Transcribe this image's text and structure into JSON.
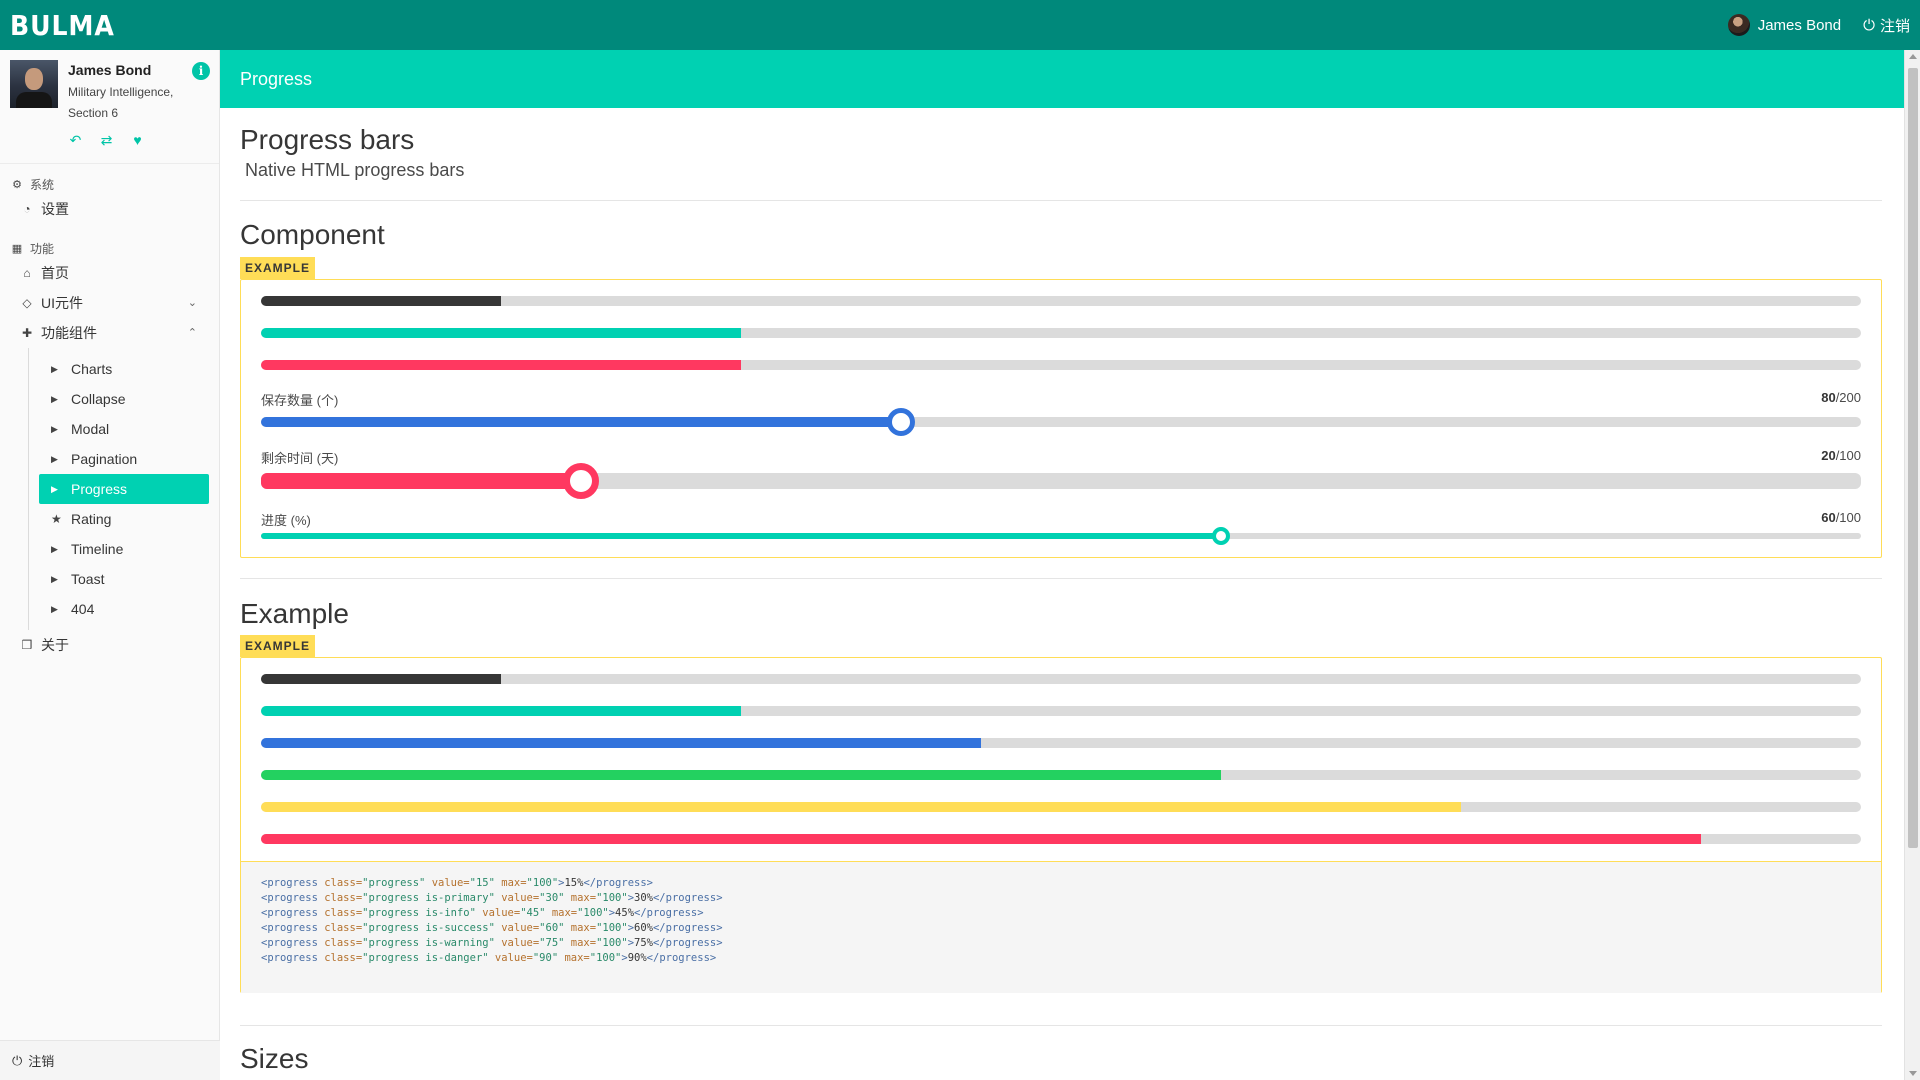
{
  "navbar": {
    "brand": "BULMA",
    "user_name": "James Bond",
    "logout_label": "注销",
    "logout_icon": "power-icon"
  },
  "sidebar": {
    "profile": {
      "name": "James Bond",
      "org": "Military Intelligence, Section 6",
      "info_icon": "info-circle-icon",
      "actions": [
        "reply-icon",
        "retweet-icon",
        "heart-icon"
      ]
    },
    "group_system": {
      "label": "系统",
      "icon": "cogs-icon"
    },
    "settings": {
      "label": "设置",
      "icon": "dashboard-icon"
    },
    "group_features": {
      "label": "功能",
      "icon": "grid-icon"
    },
    "home": {
      "label": "首页",
      "icon": "home-icon"
    },
    "ui": {
      "label": "UI元件",
      "icon": "diamond-icon"
    },
    "components": {
      "label": "功能组件",
      "icon": "puzzle-icon"
    },
    "sub_items": [
      {
        "label": "Charts",
        "icon": "caret-right-icon"
      },
      {
        "label": "Collapse",
        "icon": "caret-right-icon"
      },
      {
        "label": "Modal",
        "icon": "caret-right-icon"
      },
      {
        "label": "Pagination",
        "icon": "caret-right-icon"
      },
      {
        "label": "Progress",
        "icon": "caret-right-icon",
        "active": true
      },
      {
        "label": "Rating",
        "icon": "star-icon"
      },
      {
        "label": "Timeline",
        "icon": "caret-right-icon"
      },
      {
        "label": "Toast",
        "icon": "caret-right-icon"
      },
      {
        "label": "404",
        "icon": "caret-right-icon"
      }
    ],
    "about": {
      "label": "关于",
      "icon": "cube-icon"
    },
    "footer_logout": "注销"
  },
  "hero": {
    "title": "Progress"
  },
  "page": {
    "title": "Progress bars",
    "subtitle": "Native HTML progress bars",
    "component": {
      "title": "Component",
      "badge": "EXAMPLE",
      "bars": [
        {
          "value": 15,
          "max": 100,
          "color": "#363636"
        },
        {
          "value": 30,
          "max": 100,
          "color": "#00d1b2"
        },
        {
          "value": 30,
          "max": 100,
          "color": "#ff3860"
        }
      ],
      "sliders": [
        {
          "label": "保存数量 (个)",
          "value": 80,
          "max": 200,
          "value_text": "80",
          "max_text": "/200",
          "color": "#3273dc"
        },
        {
          "label": "剩余时间 (天)",
          "value": 20,
          "max": 100,
          "value_text": "20",
          "max_text": "/100",
          "color": "#ff3860"
        },
        {
          "label": "进度 (%)",
          "value": 60,
          "max": 100,
          "value_text": "60",
          "max_text": "/100",
          "color": "#00d1b2"
        }
      ]
    },
    "example": {
      "title": "Example",
      "badge": "EXAMPLE",
      "bars": [
        {
          "value": 15,
          "max": 100,
          "color": "#363636"
        },
        {
          "value": 30,
          "max": 100,
          "color": "#00d1b2"
        },
        {
          "value": 45,
          "max": 100,
          "color": "#3273dc"
        },
        {
          "value": 60,
          "max": 100,
          "color": "#23d160"
        },
        {
          "value": 75,
          "max": 100,
          "color": "#ffdd57"
        },
        {
          "value": 90,
          "max": 100,
          "color": "#ff3860"
        }
      ],
      "code_lines": [
        {
          "cls": "progress",
          "value": "15",
          "max": "100",
          "text": "15%"
        },
        {
          "cls": "progress is-primary",
          "value": "30",
          "max": "100",
          "text": "30%"
        },
        {
          "cls": "progress is-info",
          "value": "45",
          "max": "100",
          "text": "45%"
        },
        {
          "cls": "progress is-success",
          "value": "60",
          "max": "100",
          "text": "60%"
        },
        {
          "cls": "progress is-warning",
          "value": "75",
          "max": "100",
          "text": "75%"
        },
        {
          "cls": "progress is-danger",
          "value": "90",
          "max": "100",
          "text": "90%"
        }
      ]
    },
    "sizes": {
      "title": "Sizes"
    }
  }
}
